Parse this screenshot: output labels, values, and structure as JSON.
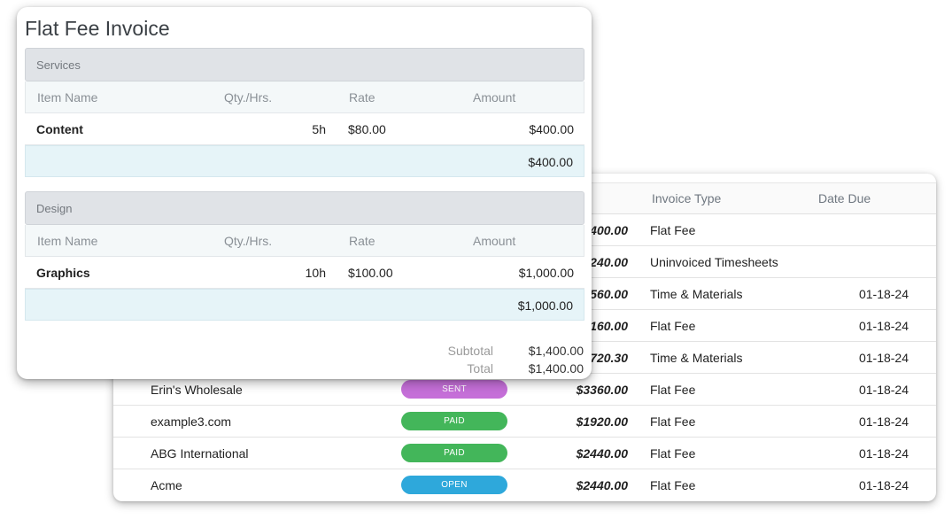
{
  "invoice_list": {
    "headers": {
      "type": "Invoice Type",
      "date": "Date Due"
    },
    "rows": [
      {
        "client": "",
        "status": "",
        "amount": "$400.00",
        "type": "Flat Fee",
        "date": ""
      },
      {
        "client": "",
        "status": "",
        "amount": "$240.00",
        "type": "Uninvoiced Timesheets",
        "date": ""
      },
      {
        "client": "",
        "status": "",
        "amount": "$560.00",
        "type": "Time & Materials",
        "date": "01-18-24"
      },
      {
        "client": "",
        "status": "",
        "amount": "$160.00",
        "type": "Flat Fee",
        "date": "01-18-24"
      },
      {
        "client": "",
        "status": "",
        "amount": "$720.30",
        "type": "Time & Materials",
        "date": "01-18-24"
      },
      {
        "client": "Erin's Wholesale",
        "status": "SENT",
        "amount": "$3360.00",
        "type": "Flat Fee",
        "date": "01-18-24"
      },
      {
        "client": "example3.com",
        "status": "PAID",
        "amount": "$1920.00",
        "type": "Flat Fee",
        "date": "01-18-24"
      },
      {
        "client": "ABG International",
        "status": "PAID",
        "amount": "$2440.00",
        "type": "Flat Fee",
        "date": "01-18-24"
      },
      {
        "client": "Acme",
        "status": "OPEN",
        "amount": "$2440.00",
        "type": "Flat Fee",
        "date": "01-18-24"
      }
    ],
    "status_colors": {
      "SENT": "#c56fd8",
      "PAID": "#43b65a",
      "OPEN": "#2ea8db"
    }
  },
  "invoice": {
    "title": "Flat Fee Invoice",
    "columns": {
      "name": "Item Name",
      "qty": "Qty./Hrs.",
      "rate": "Rate",
      "amount": "Amount"
    },
    "sections": [
      {
        "name": "Services",
        "item": {
          "name": "Content",
          "qty": "5h",
          "rate": "$80.00",
          "amount": "$400.00"
        },
        "total": "$400.00"
      },
      {
        "name": "Design",
        "item": {
          "name": "Graphics",
          "qty": "10h",
          "rate": "$100.00",
          "amount": "$1,000.00"
        },
        "total": "$1,000.00"
      }
    ],
    "subtotal_label": "Subtotal",
    "subtotal": "$1,400.00",
    "total_label": "Total",
    "total": "$1,400.00"
  }
}
